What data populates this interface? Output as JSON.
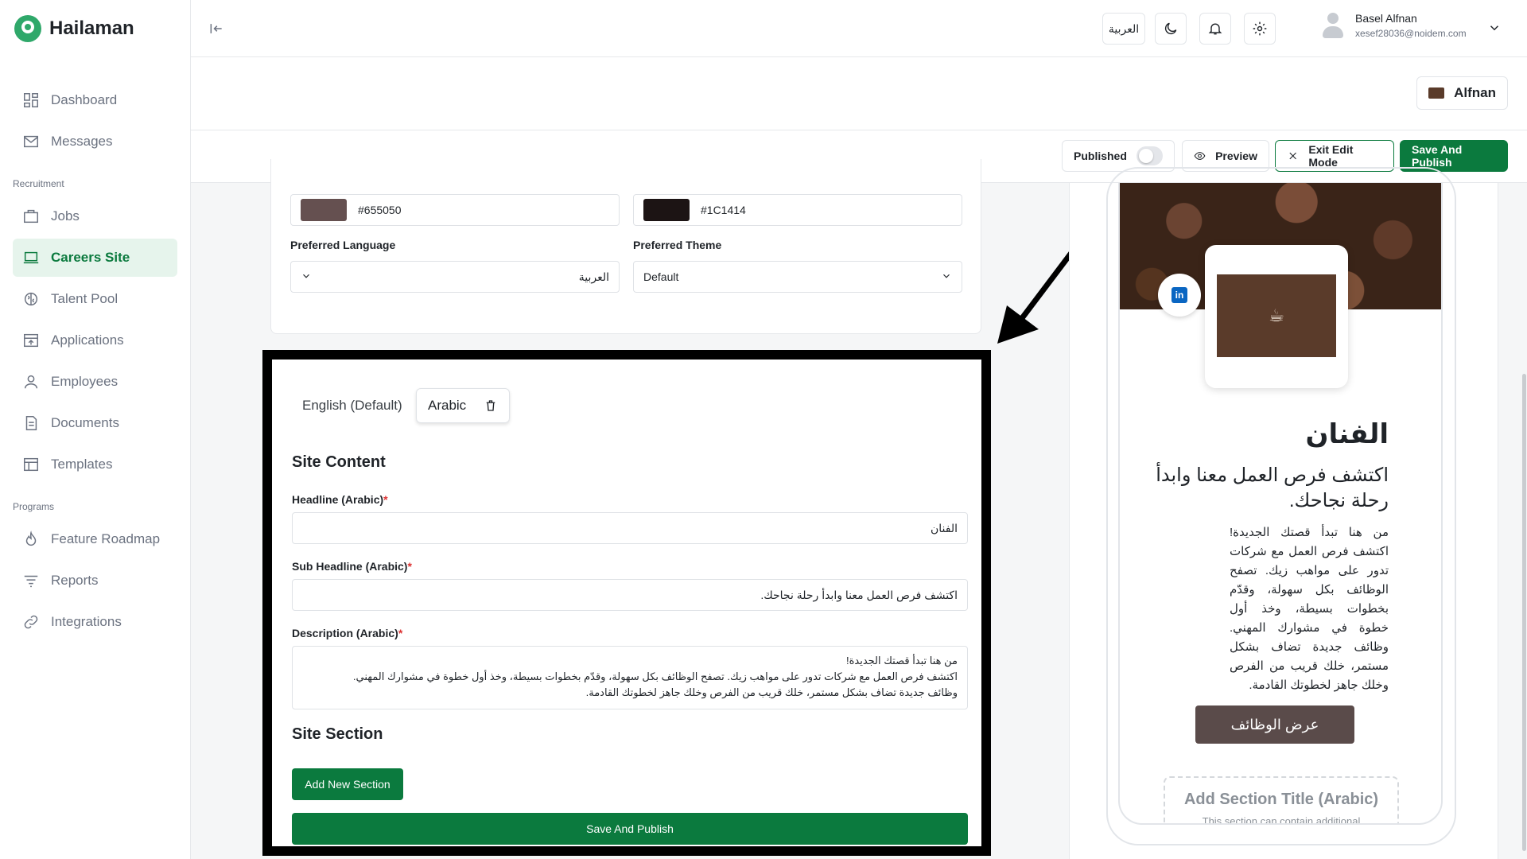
{
  "brand": {
    "name": "Hailaman"
  },
  "sidebar": {
    "items": [
      {
        "label": "Dashboard",
        "icon": "dashboard-icon"
      },
      {
        "label": "Messages",
        "icon": "mail-icon"
      }
    ],
    "groups": [
      {
        "title": "Recruitment",
        "items": [
          {
            "label": "Jobs",
            "icon": "briefcase-icon"
          },
          {
            "label": "Careers Site",
            "icon": "laptop-icon",
            "active": true
          },
          {
            "label": "Talent Pool",
            "icon": "brain-icon"
          },
          {
            "label": "Applications",
            "icon": "inbox-icon"
          },
          {
            "label": "Employees",
            "icon": "user-icon"
          },
          {
            "label": "Documents",
            "icon": "document-icon"
          },
          {
            "label": "Templates",
            "icon": "layout-icon"
          }
        ]
      },
      {
        "title": "Programs",
        "items": [
          {
            "label": "Feature Roadmap",
            "icon": "flame-icon"
          },
          {
            "label": "Reports",
            "icon": "filter-icon"
          },
          {
            "label": "Integrations",
            "icon": "link-icon"
          }
        ]
      }
    ]
  },
  "topbar": {
    "language_button": "العربية",
    "user_name": "Basel Alfnan",
    "user_email": "xesef28036@noidem.com"
  },
  "company": {
    "name": "Alfnan"
  },
  "actions": {
    "published_label": "Published",
    "preview_label": "Preview",
    "exit_label": "Exit Edit Mode",
    "save_publish_label": "Save And Publish"
  },
  "settings": {
    "primary_color": "#655050",
    "secondary_color": "#1C1414",
    "preferred_language_label": "Preferred Language",
    "preferred_language_value": "العربية",
    "preferred_theme_label": "Preferred Theme",
    "preferred_theme_value": "Default"
  },
  "editor": {
    "tabs": [
      "English (Default)",
      "Arabic"
    ],
    "site_content_title": "Site Content",
    "headline_label": "Headline (Arabic)",
    "headline_value": "الفنان",
    "subheadline_label": "Sub Headline (Arabic)",
    "subheadline_value": "اكتشف فرص العمل معنا وابدأ رحلة نجاحك.",
    "description_label": "Description (Arabic)",
    "description_value": "من هنا تبدأ قصتك الجديدة!\nاكتشف فرص العمل مع شركات تدور على مواهب زيك. تصفح الوظائف بكل سهولة، وقدّم بخطوات بسيطة، وخذ أول خطوة في مشوارك المهني.\nوظائف جديدة تضاف بشكل مستمر، خلك قريب من الفرص وخلك جاهز لخطوتك القادمة.",
    "required_mark": "*",
    "site_section_title": "Site Section",
    "add_section_label": "Add New Section",
    "save_publish_label": "Save And Publish"
  },
  "preview": {
    "title": "الفنان",
    "subtitle": "اكتشف فرص العمل معنا وابدأ رحلة نجاحك.",
    "description": "من هنا تبدأ قصتك الجديدة! اكتشف فرص العمل مع شركات تدور على مواهب زيك. تصفح الوظائف بكل سهولة، وقدّم بخطوات بسيطة، وخذ أول خطوة في مشوارك المهني. وظائف جديدة تضاف بشكل مستمر، خلك قريب من الفرص وخلك جاهز لخطوتك القادمة.",
    "jobs_button": "عرض الوظائف",
    "section_title": "Add Section Title (Arabic)",
    "section_desc": "This section can contain additional",
    "linkedin_label": "in"
  },
  "colors": {
    "accent": "#0b7a3e",
    "brand_green": "#2fa86a",
    "swatch_primary": "#655050",
    "swatch_secondary": "#1C1414"
  }
}
